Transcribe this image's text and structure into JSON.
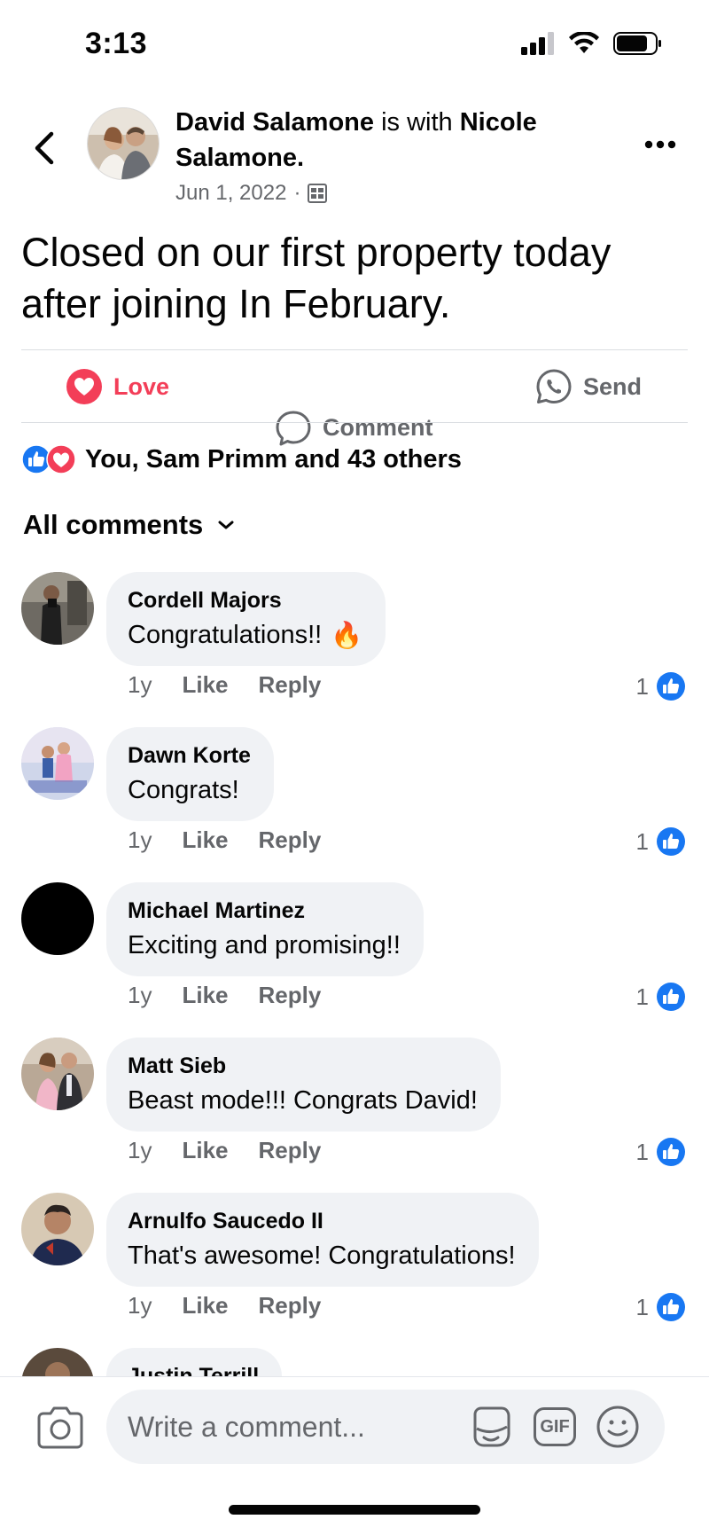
{
  "status_bar": {
    "time": "3:13"
  },
  "post": {
    "author": "David Salamone",
    "with_text": "is with",
    "tagged": "Nicole Salamone.",
    "date": "Jun 1, 2022",
    "separator": "·",
    "privacy_icon": "photo-album-icon",
    "text": "Closed on our first property today after joining In February."
  },
  "actions": {
    "love_label": "Love",
    "comment_label": "Comment",
    "send_label": "Send"
  },
  "reactions": {
    "summary": "You, Sam Primm and 43 others"
  },
  "comments_filter": {
    "label": "All comments"
  },
  "comments": [
    {
      "name": "Cordell Majors",
      "text": "Congratulations!!",
      "emoji": "🔥",
      "time": "1y",
      "like": "Like",
      "reply": "Reply",
      "likes": "1"
    },
    {
      "name": "Dawn Korte",
      "text": "Congrats!",
      "time": "1y",
      "like": "Like",
      "reply": "Reply",
      "likes": "1"
    },
    {
      "name": "Michael Martinez",
      "text": "Exciting and promising!!",
      "time": "1y",
      "like": "Like",
      "reply": "Reply",
      "likes": "1"
    },
    {
      "name": "Matt Sieb",
      "text": "Beast mode!!! Congrats David!",
      "time": "1y",
      "like": "Like",
      "reply": "Reply",
      "likes": "1"
    },
    {
      "name": "Arnulfo Saucedo II",
      "text": "That's awesome! Congratulations!",
      "time": "1y",
      "like": "Like",
      "reply": "Reply",
      "likes": "1"
    },
    {
      "name": "Justin Terrill"
    }
  ],
  "composer": {
    "placeholder": "Write a comment...",
    "gif_label": "GIF"
  },
  "colors": {
    "love": "#f33e58",
    "like_blue": "#1877f2",
    "secondary_text": "#65676b",
    "bubble": "#f0f2f5"
  }
}
